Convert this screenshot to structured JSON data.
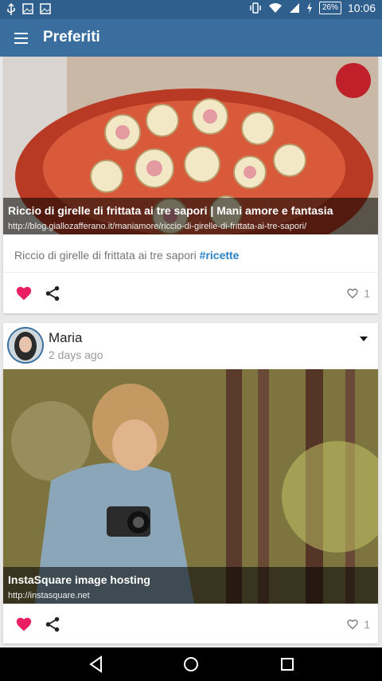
{
  "status_bar": {
    "battery": "26%",
    "time": "10:06"
  },
  "app_bar": {
    "title": "Preferiti"
  },
  "posts": [
    {
      "link_title": "Riccio di girelle di frittata ai tre sapori | Mani amore e fantasia",
      "link_url": "http://blog.giallozafferano.it/maniamore/riccio-di-girelle-di-frittata-ai-tre-sapori/",
      "text": "Riccio di girelle di frittata ai tre sapori",
      "hashtag": "#ricette",
      "likes": "1"
    },
    {
      "author": "Maria",
      "time": "2 days ago",
      "link_title": "InstaSquare image hosting",
      "link_url": "http://instasquare.net",
      "likes": "1"
    }
  ],
  "colors": {
    "app_bar": "#3a6e9f",
    "status_bar": "#2f5f8c",
    "heart": "#e91e63",
    "hashtag": "#2b82c9"
  }
}
